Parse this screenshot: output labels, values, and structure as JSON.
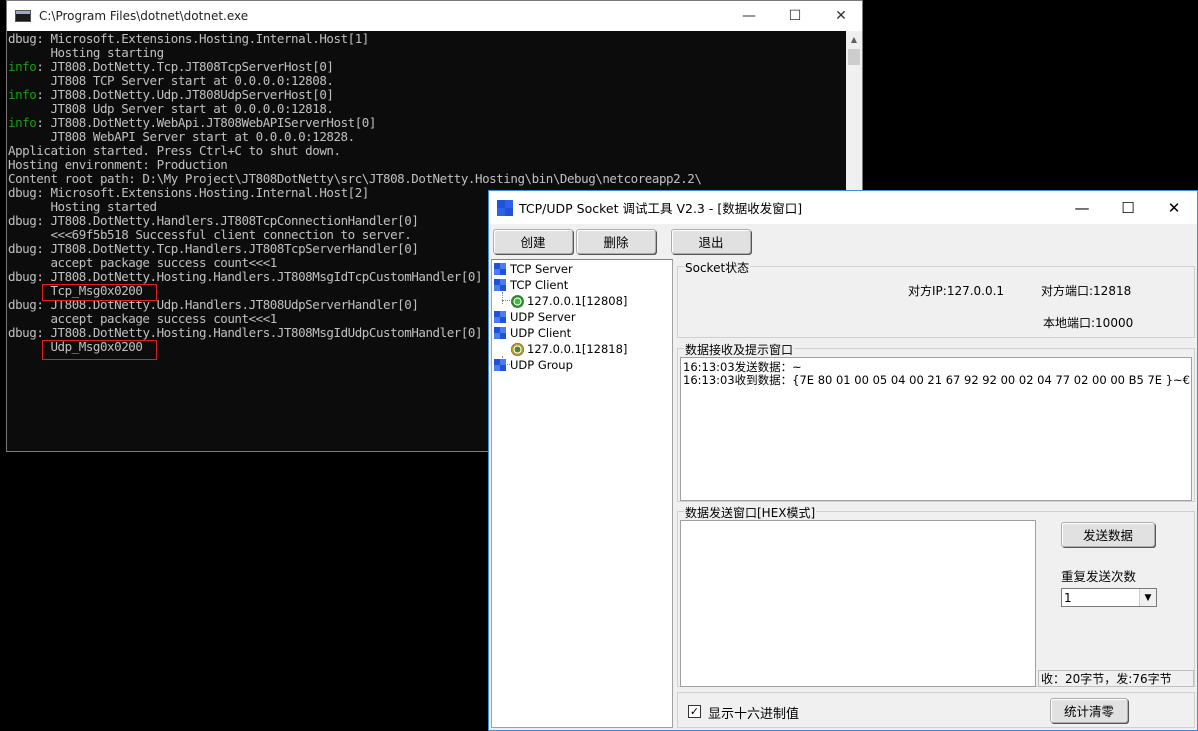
{
  "console": {
    "title": "C:\\Program Files\\dotnet\\dotnet.exe",
    "lines": [
      {
        "prefix": "dbug",
        "text": ": Microsoft.Extensions.Hosting.Internal.Host[1]"
      },
      {
        "prefix": "",
        "text": "      Hosting starting"
      },
      {
        "prefix": "info",
        "text": ": JT808.DotNetty.Tcp.JT808TcpServerHost[0]"
      },
      {
        "prefix": "",
        "text": "      JT808 TCP Server start at 0.0.0.0:12808."
      },
      {
        "prefix": "info",
        "text": ": JT808.DotNetty.Udp.JT808UdpServerHost[0]"
      },
      {
        "prefix": "",
        "text": "      JT808 Udp Server start at 0.0.0.0:12818."
      },
      {
        "prefix": "info",
        "text": ": JT808.DotNetty.WebApi.JT808WebAPIServerHost[0]"
      },
      {
        "prefix": "",
        "text": "      JT808 WebAPI Server start at 0.0.0.0:12828."
      },
      {
        "prefix": "",
        "text": "Application started. Press Ctrl+C to shut down."
      },
      {
        "prefix": "",
        "text": "Hosting environment: Production"
      },
      {
        "prefix": "",
        "text": "Content root path: D:\\My Project\\JT808DotNetty\\src\\JT808.DotNetty.Hosting\\bin\\Debug\\netcoreapp2.2\\"
      },
      {
        "prefix": "dbug",
        "text": ": Microsoft.Extensions.Hosting.Internal.Host[2]"
      },
      {
        "prefix": "",
        "text": "      Hosting started"
      },
      {
        "prefix": "dbug",
        "text": ": JT808.DotNetty.Handlers.JT808TcpConnectionHandler[0]"
      },
      {
        "prefix": "",
        "text": "      <<<69f5b518 Successful client connection to server."
      },
      {
        "prefix": "dbug",
        "text": ": JT808.DotNetty.Tcp.Handlers.JT808TcpServerHandler[0]"
      },
      {
        "prefix": "",
        "text": "      accept package success count<<<1"
      },
      {
        "prefix": "dbug",
        "text": ": JT808.DotNetty.Hosting.Handlers.JT808MsgIdTcpCustomHandler[0]"
      },
      {
        "prefix": "",
        "text": "      Tcp_Msg0x0200"
      },
      {
        "prefix": "dbug",
        "text": ": JT808.DotNetty.Udp.Handlers.JT808UdpServerHandler[0]"
      },
      {
        "prefix": "",
        "text": "      accept package success count<<<1"
      },
      {
        "prefix": "dbug",
        "text": ": JT808.DotNetty.Hosting.Handlers.JT808MsgIdUdpCustomHandler[0]"
      },
      {
        "prefix": "",
        "text": "      Udp_Msg0x0200"
      }
    ]
  },
  "tool": {
    "title": "TCP/UDP Socket 调试工具 V2.3 - [数据收发窗口]",
    "toolbar": {
      "create": "创建",
      "delete": "删除",
      "exit": "退出"
    },
    "tree": {
      "tcp_server": "TCP Server",
      "tcp_client": "TCP Client",
      "tcp_client_conn": "127.0.0.1[12808]",
      "udp_server": "UDP Server",
      "udp_client": "UDP Client",
      "udp_client_conn": "127.0.0.1[12818]",
      "udp_group": "UDP Group"
    },
    "socket_status": {
      "title": "Socket状态",
      "remote_ip": "对方IP:127.0.0.1",
      "remote_port": "对方端口:12818",
      "local_port": "本地端口:10000"
    },
    "receive": {
      "title": "数据接收及提示窗口",
      "log": "16:13:03发送数据：~\n16:13:03收到数据：{7E 80 01 00 05 04 00 21 67 92 92 00 02 04 77 02 00 00 B5 7E }~€"
    },
    "send": {
      "title": "数据发送窗口[HEX模式]",
      "value": "",
      "send_button": "发送数据",
      "repeat_label": "重复发送次数",
      "repeat_value": "1",
      "stats": "收：20字节，发:76字节"
    },
    "bottom": {
      "hex_checkbox_label": "显示十六进制值",
      "hex_checked": true,
      "reset_button": "统计清零"
    }
  }
}
